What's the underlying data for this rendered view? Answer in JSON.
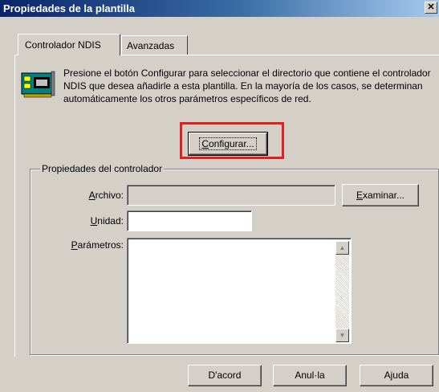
{
  "window": {
    "title": "Propiedades de la plantilla",
    "close_label": "✕"
  },
  "tabs": [
    {
      "label": "Controlador NDIS",
      "active": true
    },
    {
      "label": "Avanzadas",
      "active": false
    }
  ],
  "description": "Presione el botón Configurar para seleccionar el directorio que contiene el controlador NDIS que desea añadirle a esta plantilla. En la mayoría de los casos, se determinan automáticamente los otros parámetros específicos de red.",
  "configure_button": {
    "mnemonic": "C",
    "rest": "onfigurar..."
  },
  "group": {
    "label": "Propiedades del controlador",
    "archivo": {
      "mnemonic": "A",
      "rest": "rchivo:",
      "value": ""
    },
    "browse_button": {
      "mnemonic": "E",
      "rest": "xaminar..."
    },
    "unidad": {
      "mnemonic": "U",
      "rest": "nidad:",
      "value": ""
    },
    "parametros": {
      "mnemonic": "P",
      "rest": "arámetros:",
      "value": ""
    }
  },
  "footer": {
    "ok": "D'acord",
    "cancel": "Anul·la",
    "help": "Ajuda"
  },
  "colors": {
    "titlebar_start": "#0a246a",
    "titlebar_end": "#a6caf0",
    "highlight": "#e02020",
    "face": "#d4d0c8"
  }
}
